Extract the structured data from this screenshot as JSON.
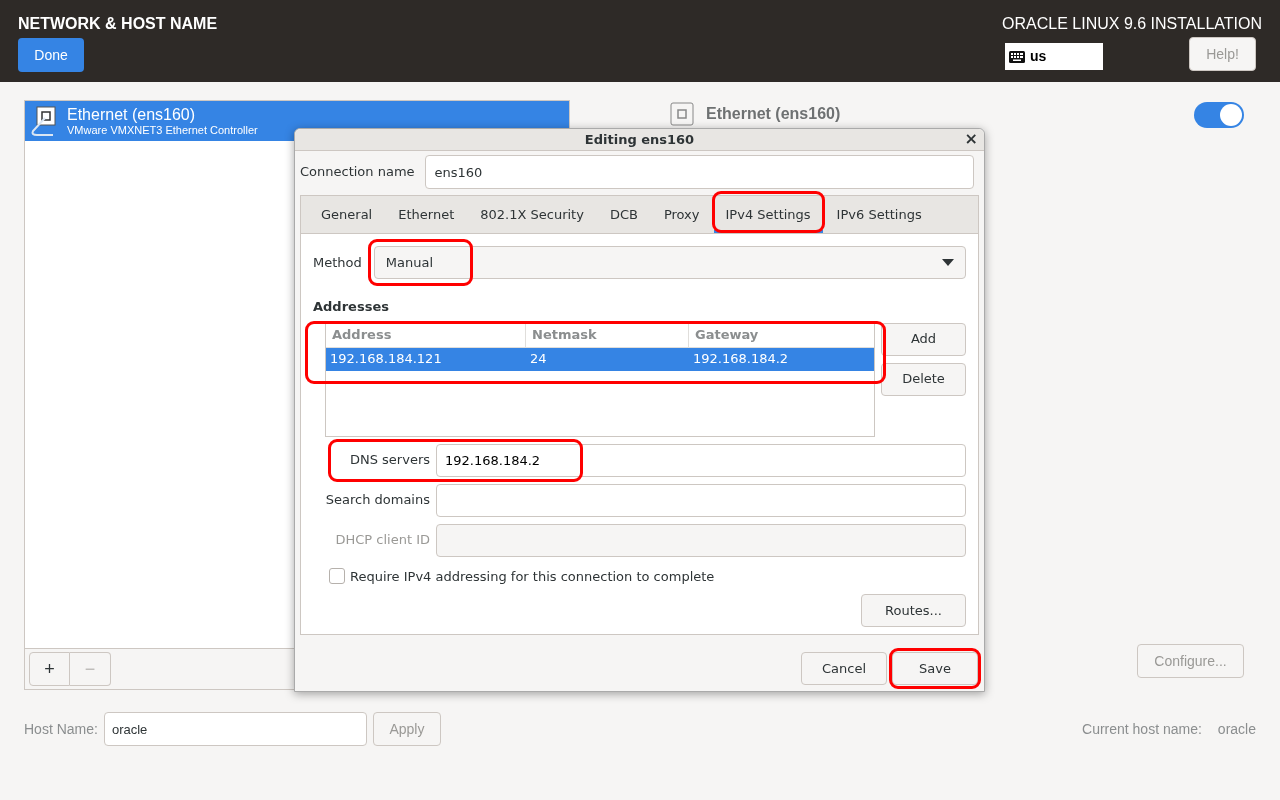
{
  "header": {
    "title": "NETWORK & HOST NAME",
    "done_button": "Done",
    "product": "ORACLE LINUX 9.6 INSTALLATION",
    "keyboard_layout": "us",
    "help_button": "Help!"
  },
  "devices": [
    {
      "name": "Ethernet (ens160)",
      "description": "VMware VMXNET3 Ethernet Controller",
      "selected": true
    }
  ],
  "device_list_buttons": [
    {
      "label": "+",
      "disabled": false
    },
    {
      "label": "−",
      "disabled": true
    }
  ],
  "device_detail": {
    "name": "Ethernet (ens160)",
    "switch_on": true,
    "configure_button": "Configure..."
  },
  "host_name": {
    "label": "Host Name:",
    "value": "oracle",
    "apply_button": "Apply",
    "current_label": "Current host name:",
    "current_value": "oracle"
  },
  "dialog": {
    "title": "Editing ens160",
    "close": "×",
    "connection_name_label": "Connection name",
    "connection_name_value": "ens160",
    "tabs": [
      {
        "label": "General",
        "selected": false,
        "annotated": false
      },
      {
        "label": "Ethernet",
        "selected": false,
        "annotated": false
      },
      {
        "label": "802.1X Security",
        "selected": false,
        "annotated": false
      },
      {
        "label": "DCB",
        "selected": false,
        "annotated": false
      },
      {
        "label": "Proxy",
        "selected": false,
        "annotated": false
      },
      {
        "label": "IPv4 Settings",
        "selected": true,
        "annotated": true
      },
      {
        "label": "IPv6 Settings",
        "selected": false,
        "annotated": false
      }
    ],
    "method": {
      "label": "Method",
      "value": "Manual",
      "annotated": true
    },
    "addresses": {
      "label": "Addresses",
      "annotated": true,
      "columns": [
        "Address",
        "Netmask",
        "Gateway"
      ],
      "rows": [
        {
          "cells": [
            "192.168.184.121",
            "24",
            "192.168.184.2"
          ],
          "selected": true
        }
      ]
    },
    "add_button": "Add",
    "delete_button": "Delete",
    "fields": [
      {
        "label": "DNS servers",
        "value": "192.168.184.2",
        "disabled": false,
        "annotated": true
      },
      {
        "label": "Search domains",
        "disabled": false,
        "annotated": false
      },
      {
        "label": "DHCP client ID",
        "disabled": true,
        "annotated": false
      }
    ],
    "checkbox": {
      "label": "Require IPv4 addressing for this connection to complete",
      "checked": false
    },
    "routes_button": "Routes...",
    "cancel_button": {
      "label": "Cancel",
      "annotated": false
    },
    "save_button": {
      "label": "Save",
      "annotated": true
    }
  }
}
